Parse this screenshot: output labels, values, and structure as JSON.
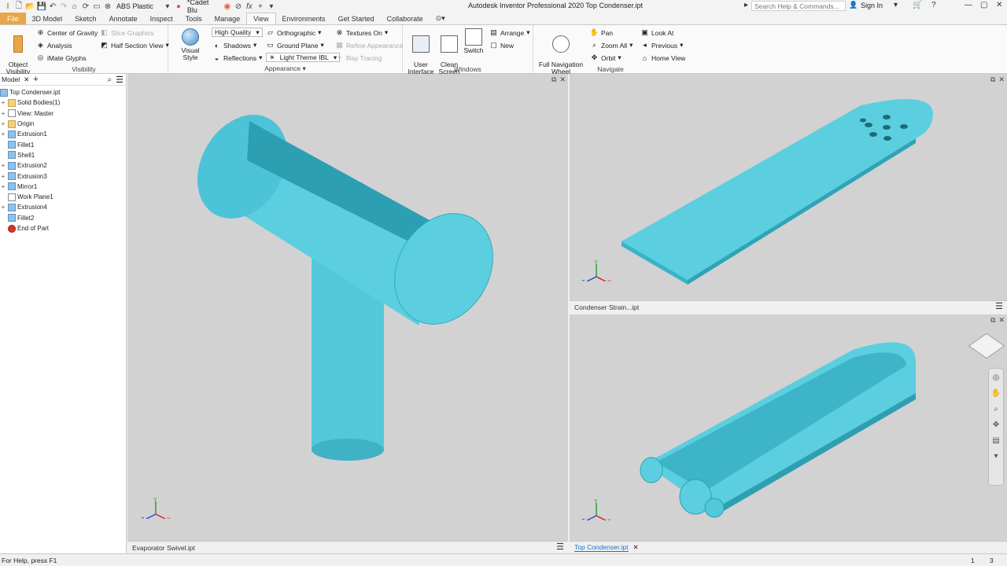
{
  "window": {
    "title": "Autodesk Inventor Professional 2020   Top Condenser.ipt",
    "search_placeholder": "Search Help & Commands...",
    "sign_in": "Sign In",
    "material": "ABS Plastic",
    "appearance": "*Cadet Blu"
  },
  "tabs": [
    "File",
    "3D Model",
    "Sketch",
    "Annotate",
    "Inspect",
    "Tools",
    "Manage",
    "View",
    "Environments",
    "Get Started",
    "Collaborate"
  ],
  "active_tab": "View",
  "ribbon": {
    "visibility": {
      "label": "Visibility",
      "object_visibility": "Object\nVisibility",
      "center_of_gravity": "Center of Gravity",
      "slice_graphics": "Slice Graphics",
      "analysis": "Analysis",
      "half_section_view": "Half Section View",
      "imate_glyphs": "iMate Glyphs"
    },
    "appearance": {
      "label": "Appearance",
      "visual_style": "Visual Style",
      "quality": "High Quality",
      "orthographic": "Orthographic",
      "textures_on": "Textures On",
      "shadows": "Shadows",
      "ground_plane": "Ground Plane",
      "refine_appearance": "Refine Appearance",
      "reflections": "Reflections",
      "light_theme": "Light Theme IBL",
      "ray_tracing": "Ray Tracing"
    },
    "windows": {
      "label": "Windows",
      "user_interface": "User\nInterface",
      "clean_screen": "Clean\nScreen",
      "switch": "Switch",
      "arrange": "Arrange",
      "new": "New"
    },
    "navigate": {
      "label": "Navigate",
      "full_nav_wheel": "Full Navigation\nWheel",
      "pan": "Pan",
      "zoom_all": "Zoom All",
      "orbit": "Orbit",
      "look_at": "Look At",
      "previous": "Previous",
      "home_view": "Home View"
    }
  },
  "browser": {
    "tab": "Model",
    "root": "Top Condenser.ipt",
    "nodes": [
      {
        "label": "Solid Bodies(1)",
        "expand": "+",
        "icon": "folder"
      },
      {
        "label": "View: Master",
        "expand": "+",
        "icon": "sketch"
      },
      {
        "label": "Origin",
        "expand": "+",
        "icon": "folder"
      },
      {
        "label": "Extrusion1",
        "expand": "+",
        "icon": "feature"
      },
      {
        "label": "Fillet1",
        "expand": "",
        "icon": "feature"
      },
      {
        "label": "Shell1",
        "expand": "",
        "icon": "feature"
      },
      {
        "label": "Extrusion2",
        "expand": "+",
        "icon": "feature"
      },
      {
        "label": "Extrusion3",
        "expand": "+",
        "icon": "feature"
      },
      {
        "label": "Mirror1",
        "expand": "+",
        "icon": "feature"
      },
      {
        "label": "Work Plane1",
        "expand": "",
        "icon": "sketch"
      },
      {
        "label": "Extrusion4",
        "expand": "+",
        "icon": "feature"
      },
      {
        "label": "Fillet2",
        "expand": "",
        "icon": "feature"
      },
      {
        "label": "End of Part",
        "expand": "",
        "icon": "err"
      }
    ]
  },
  "viewports": {
    "left": "Evaporator Swivel.ipt",
    "top_right": "Condenser Strain...ipt",
    "bottom_right": "Top Condenser.ipt"
  },
  "status": {
    "help": "For Help, press F1",
    "num1": "1",
    "num2": "3"
  },
  "colors": {
    "model": "#5bcfe0",
    "model_dark": "#2aa6bb",
    "viewport_bg": "#d2d2d2",
    "file_tab": "#e8a64a",
    "accent": "#1a73c7"
  }
}
